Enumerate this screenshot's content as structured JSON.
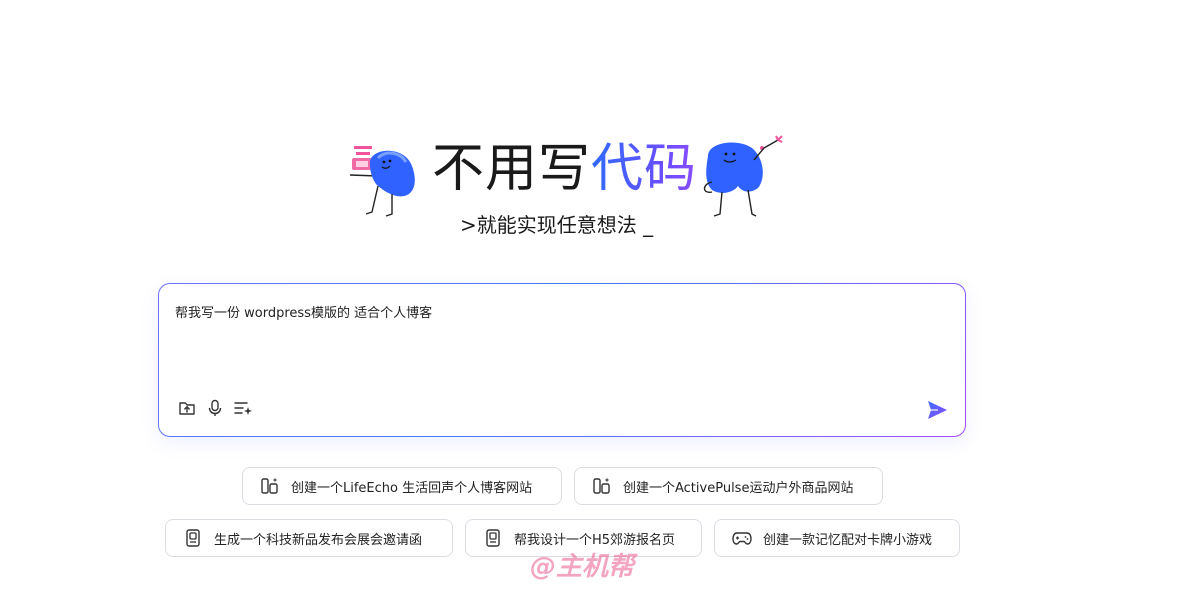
{
  "hero": {
    "title_part1": "不用写",
    "title_part2": "代码",
    "subtitle": ">就能实现任意想法 _"
  },
  "prompt": {
    "value": "帮我写一份 wordpress模版的 适合个人博客",
    "tools": [
      "upload-icon",
      "microphone-icon",
      "prompt-optimize-icon"
    ],
    "send_icon": "send-icon"
  },
  "suggestions": {
    "row1": [
      {
        "label": "创建一个LifeEcho 生活回声个人博客网站",
        "icon": "website-icon"
      },
      {
        "label": "创建一个ActivePulse运动户外商品网站",
        "icon": "website-icon"
      }
    ],
    "row2": [
      {
        "label": "生成一个科技新品发布会展会邀请函",
        "icon": "invitation-icon"
      },
      {
        "label": "帮我设计一个H5郊游报名页",
        "icon": "invitation-icon"
      },
      {
        "label": "创建一款记忆配对卡牌小游戏",
        "icon": "gamepad-icon"
      }
    ]
  },
  "watermark": "@主机帮",
  "colors": {
    "accent_blue": "#2f6bff",
    "accent_purple": "#8b4dff",
    "chip_border": "#dcdde3"
  }
}
